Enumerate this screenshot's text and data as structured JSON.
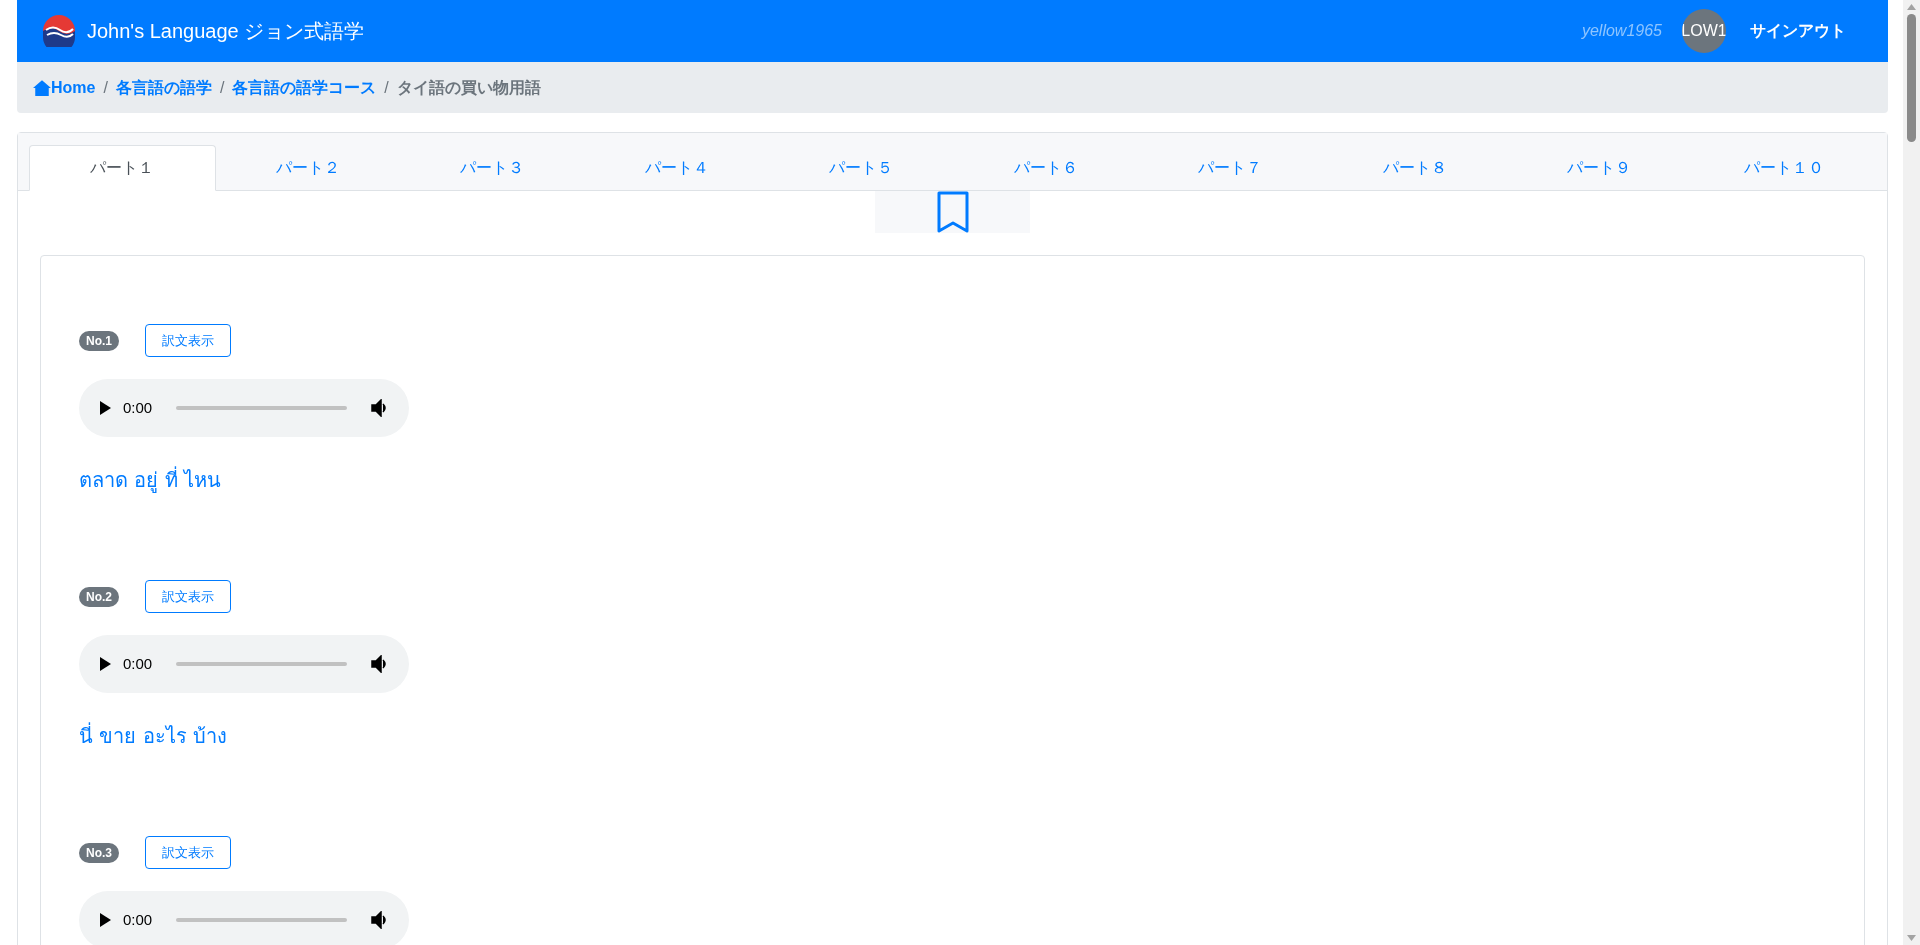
{
  "navbar": {
    "brand": "John's Language ジョン式語学",
    "username": "yellow1965",
    "avatar": "LOW1",
    "signout": "サインアウト"
  },
  "breadcrumb": [
    {
      "label": "Home",
      "kind": "home",
      "link": true
    },
    {
      "separator": "/",
      "label": "各言語の語学",
      "kind": "text",
      "link": true
    },
    {
      "separator": "/",
      "label": "各言語の語学コース",
      "kind": "text",
      "link": true
    },
    {
      "separator": "/",
      "label": "タイ語の買い物用語",
      "kind": "text",
      "link": false
    }
  ],
  "tabs": [
    {
      "label": "パート１",
      "selected": true
    },
    {
      "label": "パート２",
      "selected": false
    },
    {
      "label": "パート３",
      "selected": false
    },
    {
      "label": "パート４",
      "selected": false
    },
    {
      "label": "パート５",
      "selected": false
    },
    {
      "label": "パート６",
      "selected": false
    },
    {
      "label": "パート７",
      "selected": false
    },
    {
      "label": "パート８",
      "selected": false
    },
    {
      "label": "パート９",
      "selected": false
    },
    {
      "label": "パート１０",
      "selected": false
    }
  ],
  "items": [
    {
      "number": "No.1",
      "button": "訳文表示",
      "time": "0:00",
      "phrase": "ตลาด อยู่ ที่ ไหน"
    },
    {
      "number": "No.2",
      "button": "訳文表示",
      "time": "0:00",
      "phrase": "นี่ ขาย อะไร บ้าง"
    },
    {
      "number": "No.3",
      "button": "訳文表示",
      "time": "0:00"
    }
  ]
}
